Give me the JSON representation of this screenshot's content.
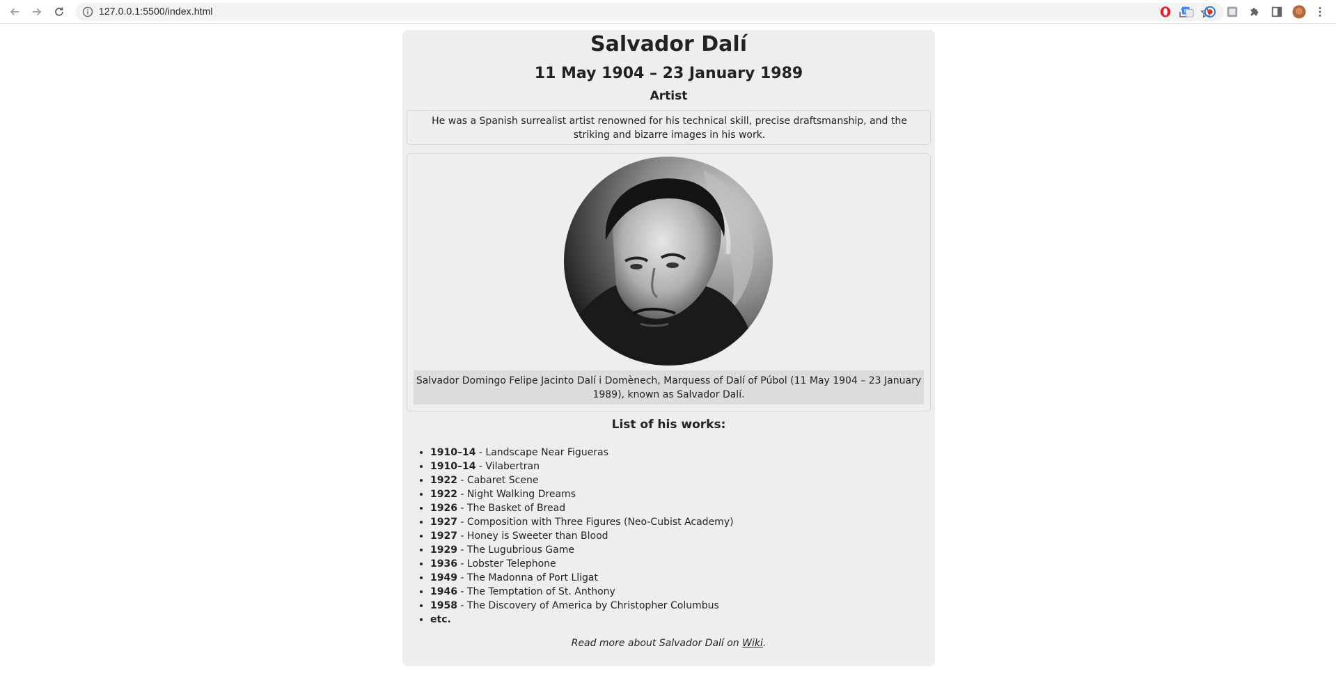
{
  "browser": {
    "url": "127.0.0.1:5500/index.html"
  },
  "page": {
    "title": "Salvador Dalí",
    "dates": "11 May 1904 – 23 January 1989",
    "role": "Artist",
    "description": "He was a Spanish surrealist artist renowned for his technical skill, precise draftsmanship, and the striking and bizarre images in his work.",
    "caption": "Salvador Domingo Felipe Jacinto Dalí i Domènech, Marquess of Dalí of Púbol (11 May 1904 – 23 January 1989), known as Salvador Dalí.",
    "list_title": "List of his works:",
    "works": [
      {
        "year": "1910–14",
        "title": " - Landscape Near Figueras"
      },
      {
        "year": "1910–14",
        "title": " - Vilabertran"
      },
      {
        "year": "1922",
        "title": " - Cabaret Scene"
      },
      {
        "year": "1922",
        "title": " - Night Walking Dreams"
      },
      {
        "year": "1926",
        "title": " - The Basket of Bread"
      },
      {
        "year": "1927",
        "title": " - Composition with Three Figures (Neo-Cubist Academy)"
      },
      {
        "year": "1927",
        "title": " - Honey is Sweeter than Blood"
      },
      {
        "year": "1929",
        "title": " - The Lugubrious Game"
      },
      {
        "year": "1936",
        "title": " - Lobster Telephone"
      },
      {
        "year": "1949",
        "title": " - The Madonna of Port Lligat"
      },
      {
        "year": "1946",
        "title": " - The Temptation of St. Anthony"
      },
      {
        "year": "1958",
        "title": " - The Discovery of America by Christopher Columbus"
      },
      {
        "year": "etc.",
        "title": ""
      }
    ],
    "footer_prefix": "Read more about Salvador Dalí on ",
    "footer_link": "Wiki",
    "footer_suffix": "."
  }
}
